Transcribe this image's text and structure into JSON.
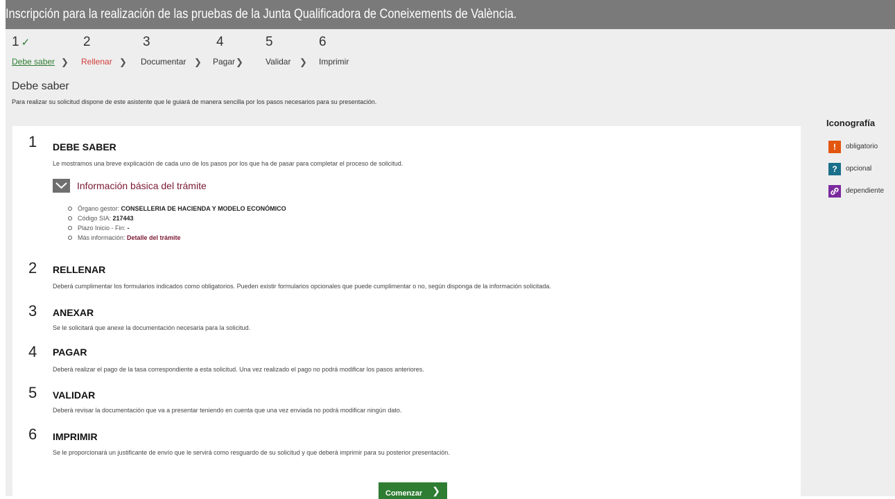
{
  "header": {
    "title": "Inscripción para la realización de las pruebas de la Junta Qualificadora de Coneixements de València."
  },
  "steps": [
    {
      "num": "1",
      "label": "Debe saber",
      "state": "done"
    },
    {
      "num": "2",
      "label": "Rellenar",
      "state": "active"
    },
    {
      "num": "3",
      "label": "Documentar",
      "state": "pending"
    },
    {
      "num": "4",
      "label": "Pagar",
      "state": "pending"
    },
    {
      "num": "5",
      "label": "Validar",
      "state": "pending"
    },
    {
      "num": "6",
      "label": "Imprimir",
      "state": "pending"
    }
  ],
  "step_check_icon": "check-icon",
  "step_separator_icon": "chevron-right-icon",
  "section": {
    "title": "Debe saber",
    "subtitle": "Para realizar su solicitud dispone de este asistente que le guiará de manera sencilla por los pasos necesarios para su presentación."
  },
  "blocks": [
    {
      "num": "1",
      "title": "DEBE SABER",
      "desc": "Le mostramos una breve explicación de cada uno de los pasos por los que ha de pasar para completar el proceso de solicitud."
    },
    {
      "num": "2",
      "title": "RELLENAR",
      "desc": "Deberá cumplimentar los formularios indicados como obligatorios. Pueden existir formularios opcionales que puede cumplimentar o no, según disponga de la información solicitada."
    },
    {
      "num": "3",
      "title": "ANEXAR",
      "desc": "Se le solicitará que anexe la documentación necesaria para la solicitud."
    },
    {
      "num": "4",
      "title": "PAGAR",
      "desc": "Deberá realizar el pago de la tasa correspondiente a esta solicitud. Una vez realizado el pago no podrá modificar los pasos anteriores."
    },
    {
      "num": "5",
      "title": "VALIDAR",
      "desc": "Deberá revisar la documentación que va a presentar teniendo en cuenta que una vez enviada no podrá modificar ningún dato."
    },
    {
      "num": "6",
      "title": "IMPRIMIR",
      "desc": "Se le proporcionará un justificante de envío que le servirá como resguardo de su solicitud y que deberá imprimir para su posterior presentación."
    }
  ],
  "info": {
    "title": "Información básica del trámite",
    "toggle_icon": "chevron-down-icon",
    "items": [
      {
        "label": "Órgano gestor: ",
        "value": "CONSELLERIA DE HACIENDA Y MODELO ECONÓMICO"
      },
      {
        "label": "Código SIA: ",
        "value": "217443"
      },
      {
        "label": "Plazo Inicio - Fin: ",
        "value": "-"
      },
      {
        "label": "Más información: ",
        "value": "Detalle del trámite"
      }
    ]
  },
  "start_button": {
    "label": "Comenzar",
    "icon": "chevron-right-icon"
  },
  "iconografia": {
    "title": "Iconografía",
    "items": [
      {
        "glyph": "!",
        "label": "obligatorio",
        "color": "#e2560f",
        "icon": "exclamation-icon"
      },
      {
        "glyph": "?",
        "label": "opcional",
        "color": "#1a6f8a",
        "icon": "question-icon"
      },
      {
        "glyph": "🔗",
        "label": "dependiente",
        "color": "#7b2a9e",
        "icon": "link-icon"
      }
    ]
  },
  "colors": {
    "title_bar": "#7a7a7a",
    "done": "#2e7d32",
    "active": "#d23b3b",
    "accent": "#7a1732",
    "button": "#2e7d32"
  }
}
